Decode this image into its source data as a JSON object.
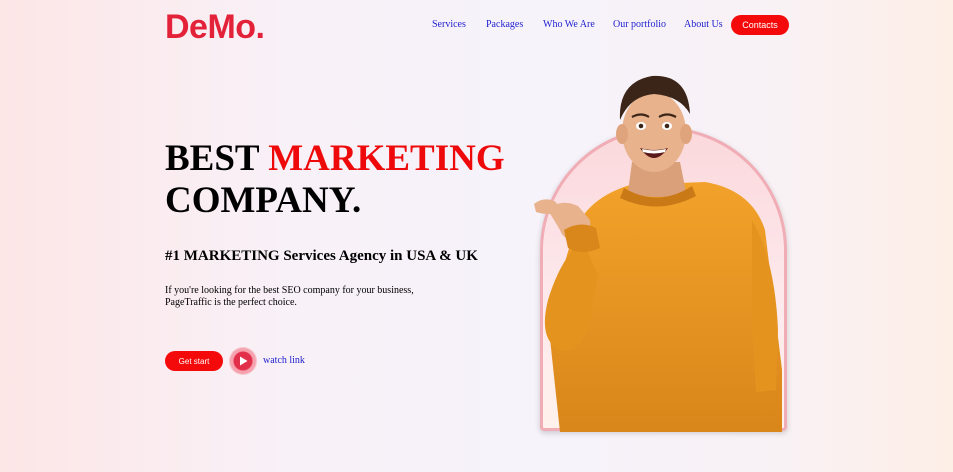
{
  "brand": {
    "logo": "DeMo."
  },
  "nav": {
    "links": [
      "Services",
      "Packages",
      "Who We Are",
      "Our portfolio",
      "About Us"
    ],
    "cta": "Contacts"
  },
  "hero": {
    "headline_word1": "BEST",
    "headline_highlight": "MARKETING",
    "headline_line2": "COMPANY.",
    "subheading": "#1 MARKETING Services Agency in USA & UK",
    "description_line1": "If you're looking for the best SEO company for your business,",
    "description_line2": "PageTraffic is the perfect choice.",
    "primary_button": "Get start",
    "watch_link": "watch link",
    "play_icon": "play-icon"
  },
  "image": {
    "alt": "Smiling man in orange sweater pointing"
  },
  "colors": {
    "brand": "#e3223a",
    "accent": "#f40a0a",
    "link": "#1e1ecf"
  }
}
